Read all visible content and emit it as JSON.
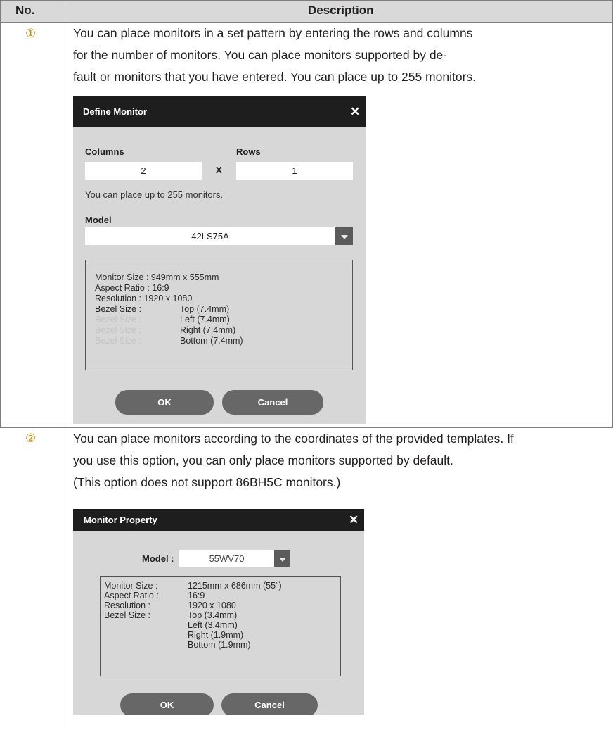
{
  "table": {
    "header": {
      "no": "No.",
      "description": "Description"
    }
  },
  "rows": [
    {
      "number": "①",
      "paragraph": [
        "You can place monitors in a set pattern by entering the rows and columns",
        "for the number of monitors. You can place monitors supported by de-",
        "fault or monitors that you have entered. You can place up to 255 monitors."
      ]
    },
    {
      "number": "②",
      "paragraph": [
        "You can place monitors according to the coordinates of the provided templates. If",
        "you use this option, you can only place monitors supported by default.",
        "(This option does not support 86BH5C monitors.)"
      ]
    }
  ],
  "define_monitor": {
    "title": "Define Monitor",
    "close_icon": "close-icon",
    "columns_label": "Columns",
    "rows_label": "Rows",
    "columns_value": "2",
    "times": "X",
    "rows_value": "1",
    "hint": "You can place up to 255 monitors.",
    "model_label": "Model",
    "model_value": "42LS75A",
    "info": {
      "monitor_size": "Monitor Size : 949mm x 555mm",
      "aspect_ratio": "Aspect Ratio : 16:9",
      "resolution": "Resolution : 1920 x 1080",
      "bezel_label": "Bezel Size :",
      "ghost_label": "Bezel Size :",
      "bezel_top": "Top (7.4mm)",
      "bezel_left": "Left (7.4mm)",
      "bezel_right": "Right (7.4mm)",
      "bezel_bottom": "Bottom (7.4mm)"
    },
    "ok_label": "OK",
    "cancel_label": "Cancel"
  },
  "monitor_property": {
    "title": "Monitor Property",
    "close_icon": "close-icon",
    "model_label": "Model :",
    "model_value": "55WV70",
    "info": {
      "monitor_size_label": "Monitor Size :",
      "monitor_size_value": "1215mm x 686mm (55\")",
      "aspect_ratio_label": "Aspect Ratio :",
      "aspect_ratio_value": "16:9",
      "resolution_label": "Resolution :",
      "resolution_value": "1920 x 1080",
      "bezel_label": "Bezel Size :",
      "bezel_top": "Top (3.4mm)",
      "bezel_left": "Left (3.4mm)",
      "bezel_right": "Right (1.9mm)",
      "bezel_bottom": "Bottom (1.9mm)"
    },
    "ok_label": "OK",
    "cancel_label": "Cancel"
  }
}
